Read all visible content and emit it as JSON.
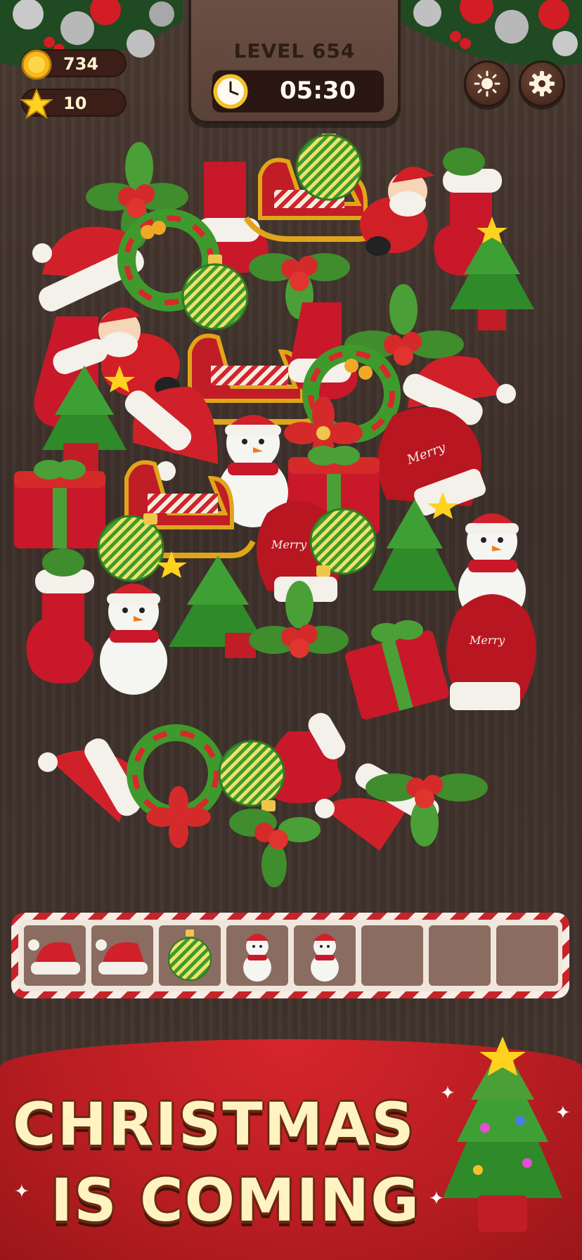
{
  "hud": {
    "coins": "734",
    "stars": "10",
    "level_label": "LEVEL 654",
    "timer": "05:30"
  },
  "tray": {
    "capacity": 7,
    "slots": [
      "santa-hat",
      "santa-hat",
      "ornament",
      "snowman",
      "snowman",
      "",
      ""
    ]
  },
  "banner": {
    "line1": "CHRISTMAS",
    "line2": "IS COMING"
  },
  "colors": {
    "wood": "#43352e",
    "panel": "#5a4238",
    "banner_red": "#c8232b",
    "banner_text": "#fff3c2"
  }
}
